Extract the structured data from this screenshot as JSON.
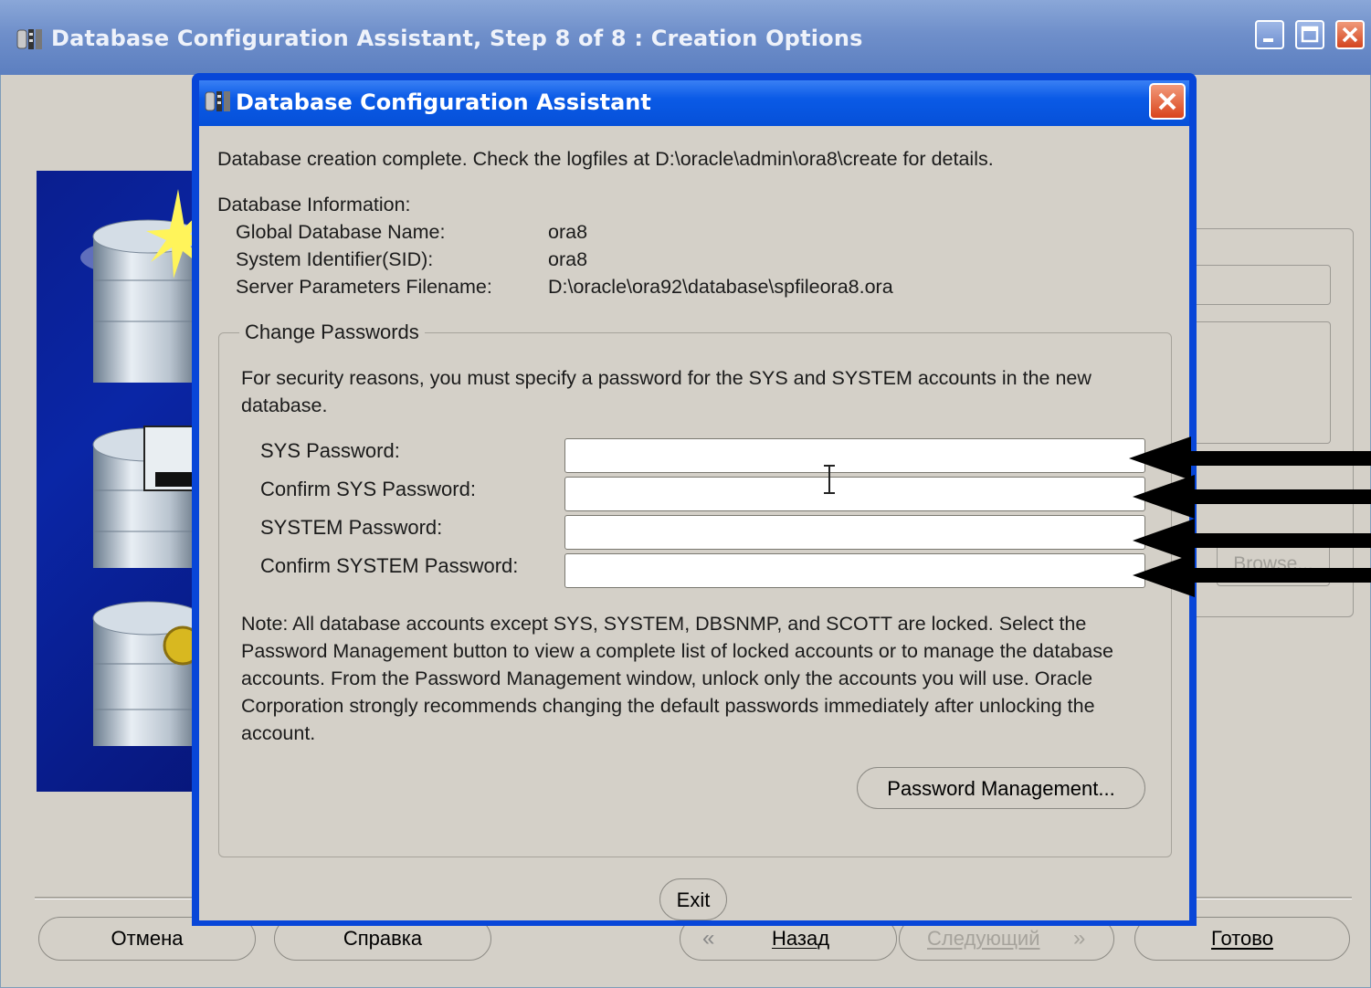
{
  "outer_window": {
    "title": "Database Configuration Assistant, Step 8 of 8 : Creation Options",
    "behind": {
      "browse_label": "Browse..."
    },
    "buttons": {
      "cancel": "Отмена",
      "help": "Справка",
      "back": "Назад",
      "next": "Следующий",
      "finish": "Готово"
    }
  },
  "dialog": {
    "title": "Database Configuration Assistant",
    "message": "Database creation complete. Check the logfiles at D:\\oracle\\admin\\ora8\\create for details.",
    "info_heading": "Database Information:",
    "info": [
      {
        "label": "Global Database Name:",
        "value": "ora8"
      },
      {
        "label": "System Identifier(SID):",
        "value": "ora8"
      },
      {
        "label": "Server Parameters Filename:",
        "value": "D:\\oracle\\ora92\\database\\spfileora8.ora"
      }
    ],
    "change_passwords": {
      "legend": "Change Passwords",
      "description": "For security reasons, you must specify a password for the SYS and SYSTEM accounts in the new database.",
      "fields": [
        {
          "label": "SYS Password:",
          "value": ""
        },
        {
          "label": "Confirm SYS Password:",
          "value": ""
        },
        {
          "label": "SYSTEM Password:",
          "value": ""
        },
        {
          "label": "Confirm SYSTEM Password:",
          "value": ""
        }
      ],
      "note": "Note: All database accounts except SYS, SYSTEM, DBSNMP, and SCOTT are locked. Select the Password Management button to view a complete list of locked accounts or to manage the database accounts. From the Password Management window, unlock only the accounts you will use. Oracle Corporation strongly recommends changing the default passwords immediately after unlocking the account.",
      "password_management_button": "Password Management..."
    },
    "exit_button": "Exit"
  },
  "annotations": {
    "arrow_color": "#000000"
  },
  "colors": {
    "xp_blue": "#0846d8",
    "dialog_bg": "#d4d0c8"
  }
}
